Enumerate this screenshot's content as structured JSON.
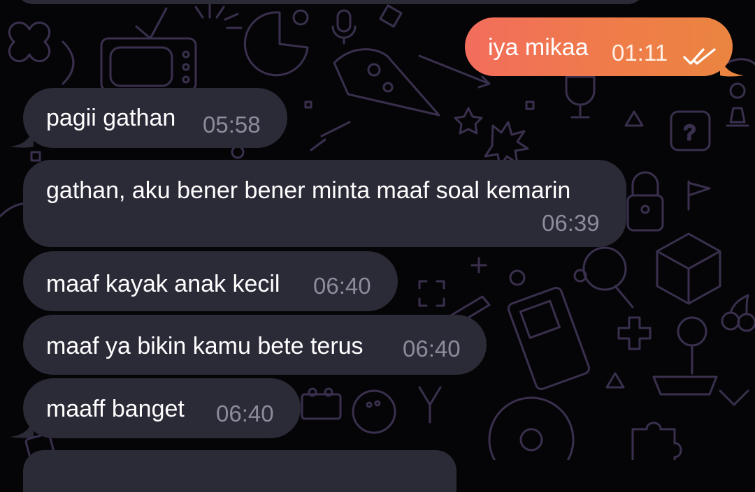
{
  "colors": {
    "incoming_bubble": "#2b2a37",
    "outgoing_bubble_start": "#f26d5c",
    "outgoing_bubble_end": "#ea8440",
    "timestamp_incoming": "#8d8c9a",
    "background": "#050507"
  },
  "messages": {
    "m0": {
      "direction": "outgoing",
      "text": "iya mikaa",
      "time": "01:11",
      "status_icon": "double-check-icon"
    },
    "m1": {
      "direction": "incoming",
      "text": "pagii gathan",
      "time": "05:58"
    },
    "m2": {
      "direction": "incoming",
      "text": "gathan, aku bener bener minta maaf soal kemarin",
      "time": "06:39"
    },
    "m3": {
      "direction": "incoming",
      "text": "maaf kayak anak kecil",
      "time": "06:40"
    },
    "m4": {
      "direction": "incoming",
      "text": "maaf ya bikin kamu bete terus",
      "time": "06:40"
    },
    "m5": {
      "direction": "incoming",
      "text": "maaff banget",
      "time": "06:40"
    }
  }
}
